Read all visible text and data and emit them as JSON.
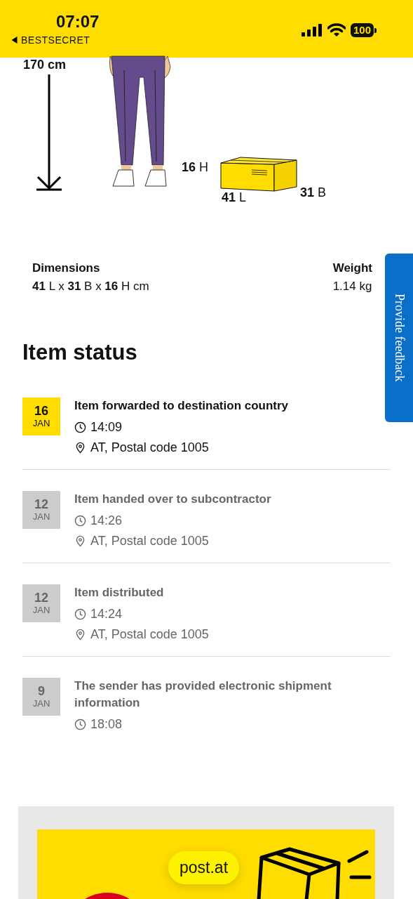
{
  "status_bar": {
    "time": "07:07",
    "back_label": "BESTSECRET",
    "battery": "100"
  },
  "illustration": {
    "person_height": "170 cm",
    "box_height": "**16** H",
    "box_length": "**41** L",
    "box_width": "**31** B"
  },
  "dimensions": {
    "label": "Dimensions",
    "value": "**41** L x **31** B x **16** H cm"
  },
  "weight": {
    "label": "Weight",
    "value": "1.14 kg"
  },
  "feedback_tab": "Provide feedback",
  "item_status": {
    "title": "Item status",
    "events": [
      {
        "day": "16",
        "month": "JAN",
        "current": true,
        "title": "Item forwarded to destination country",
        "time": "14:09",
        "location": "AT, Postal code 1005"
      },
      {
        "day": "12",
        "month": "JAN",
        "current": false,
        "title": "Item handed over to subcontractor",
        "time": "14:26",
        "location": "AT, Postal code 1005"
      },
      {
        "day": "12",
        "month": "JAN",
        "current": false,
        "title": "Item distributed",
        "time": "14:24",
        "location": "AT, Postal code 1005"
      },
      {
        "day": "9",
        "month": "JAN",
        "current": false,
        "title": "The sender has provided electronic shipment information",
        "time": "18:08"
      }
    ]
  },
  "url_pill": "post.at"
}
